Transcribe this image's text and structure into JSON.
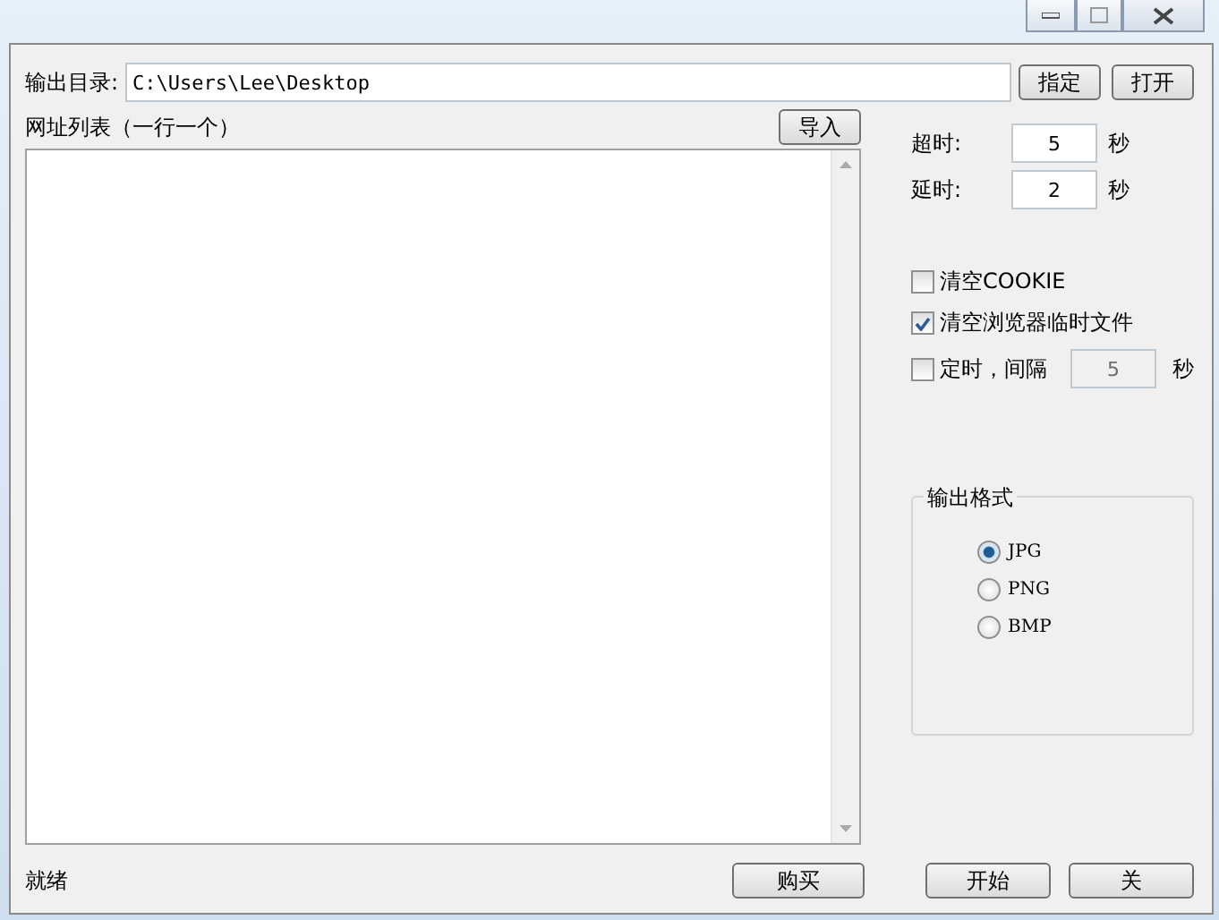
{
  "output_dir": {
    "label": "输出目录:",
    "value": "C:\\Users\\Lee\\Desktop",
    "buttons": [
      "指定",
      "打开"
    ]
  },
  "url_list": {
    "label": "网址列表（一行一个）",
    "import_button": "导入"
  },
  "timing": [
    {
      "label": "超时:",
      "value": "5",
      "unit": "秒"
    },
    {
      "label": "延时:",
      "value": "2",
      "unit": "秒"
    }
  ],
  "options": [
    {
      "label": "清空COOKIE",
      "checked": false
    },
    {
      "label": "清空浏览器临时文件",
      "checked": true
    }
  ],
  "timer": {
    "label": "定时，间隔",
    "checked": false,
    "value": "5",
    "unit": "秒"
  },
  "format": {
    "title": "输出格式",
    "choices": [
      {
        "label": "JPG",
        "selected": true
      },
      {
        "label": "PNG",
        "selected": false
      },
      {
        "label": "BMP",
        "selected": false
      }
    ]
  },
  "status": "就绪",
  "buttons": [
    "购买",
    "开始",
    "关"
  ]
}
